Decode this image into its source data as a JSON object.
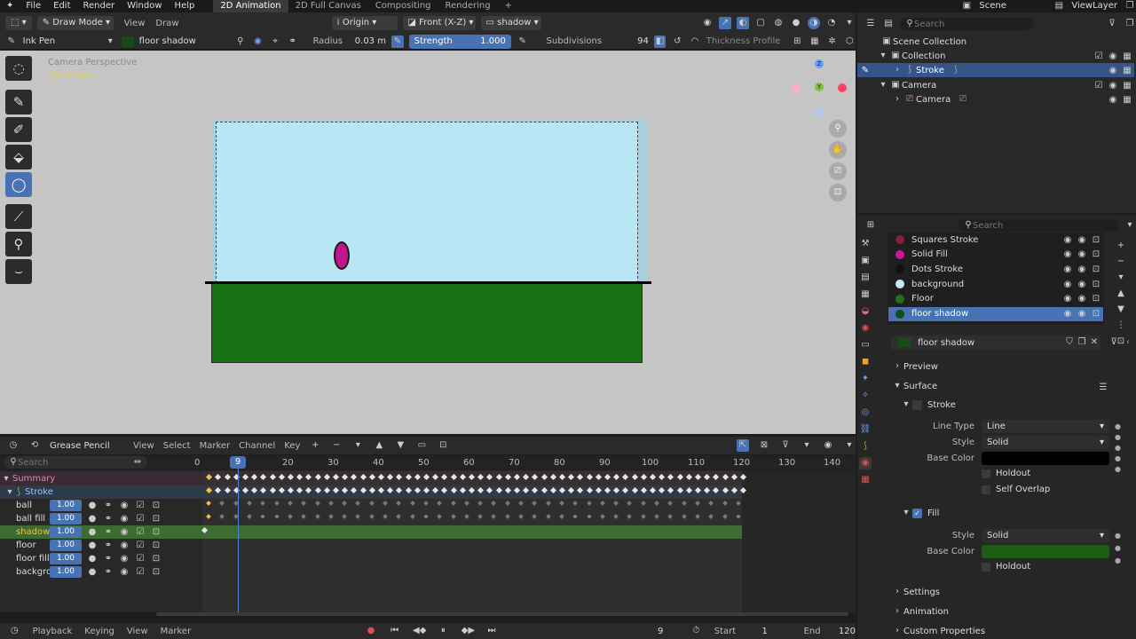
{
  "menubar": {
    "items": [
      "File",
      "Edit",
      "Render",
      "Window",
      "Help"
    ],
    "workspaces": [
      "2D Animation",
      "2D Full Canvas",
      "Compositing",
      "Rendering"
    ],
    "active_workspace": "2D Animation",
    "add_tab": "+",
    "scene": "Scene",
    "view_layer": "ViewLayer"
  },
  "viewport_header": {
    "mode": "Draw Mode",
    "view": "View",
    "draw": "Draw",
    "origin": "Origin",
    "view_axis": "Front (X-Z)",
    "layer": "shadow"
  },
  "tool_settings": {
    "brush": "Ink Pen",
    "material": "floor shadow",
    "radius_label": "Radius",
    "radius_value": "0.03 m",
    "strength_label": "Strength",
    "strength_value": "1.000",
    "subdivisions_label": "Subdivisions",
    "subdivisions_value": "94",
    "thickness_profile": "Thickness Profile"
  },
  "viewport": {
    "overlay_line1": "Camera Perspective",
    "overlay_line2": "(9) Stroke",
    "canvas_sky_color": "#b8e6f4",
    "canvas_floor_color": "#197012",
    "ball_color": "#c0158c",
    "bg_color": "#c5c5c5",
    "gizmo_z": "Z",
    "gizmo_y": "Y"
  },
  "outliner": {
    "search_placeholder": "Search",
    "root": "Scene Collection",
    "collection": "Collection",
    "stroke": "Stroke",
    "camera_collection": "Camera",
    "camera_object": "Camera"
  },
  "materials": {
    "search_placeholder": "Search",
    "slots": [
      {
        "name": "Squares Stroke",
        "color": "#8a1f3a"
      },
      {
        "name": "Solid Fill",
        "color": "#d014a0"
      },
      {
        "name": "Dots Stroke",
        "color": "#111111"
      },
      {
        "name": "background",
        "color": "#c7ecf7"
      },
      {
        "name": "Floor",
        "color": "#1e6f1e"
      },
      {
        "name": "floor shadow",
        "color": "#164d16"
      }
    ],
    "active_name": "floor shadow"
  },
  "properties": {
    "preview": "Preview",
    "surface": "Surface",
    "stroke_section": "Stroke",
    "line_type_label": "Line Type",
    "line_type_value": "Line",
    "style_label": "Style",
    "style_value": "Solid",
    "base_color_label": "Base Color",
    "stroke_color": "#000000",
    "holdout": "Holdout",
    "self_overlap": "Self Overlap",
    "fill_section": "Fill",
    "fill_style_label": "Style",
    "fill_style_value": "Solid",
    "fill_base_color_label": "Base Color",
    "fill_color": "#1b5e14",
    "fill_holdout": "Holdout",
    "settings": "Settings",
    "animation": "Animation",
    "custom_properties": "Custom Properties"
  },
  "dopesheet": {
    "mode": "Grease Pencil",
    "menus": [
      "View",
      "Select",
      "Marker",
      "Channel",
      "Key"
    ],
    "search_placeholder": "Search",
    "current_frame": "9",
    "ticks": [
      "0",
      "20",
      "30",
      "40",
      "50",
      "60",
      "70",
      "80",
      "90",
      "100",
      "110",
      "120",
      "130",
      "140"
    ],
    "summary": "Summary",
    "object": "Stroke",
    "layers": [
      {
        "name": "ball",
        "value": "1.00"
      },
      {
        "name": "ball fill",
        "value": "1.00"
      },
      {
        "name": "shadow",
        "value": "1.00"
      },
      {
        "name": "floor",
        "value": "1.00"
      },
      {
        "name": "floor fill",
        "value": "1.00"
      },
      {
        "name": "backgro",
        "value": "1.00"
      }
    ]
  },
  "timeline": {
    "playback": "Playback",
    "keying": "Keying",
    "view": "View",
    "marker": "Marker",
    "frame": "9",
    "start_label": "Start",
    "start_value": "1",
    "end_label": "End",
    "end_value": "120"
  }
}
